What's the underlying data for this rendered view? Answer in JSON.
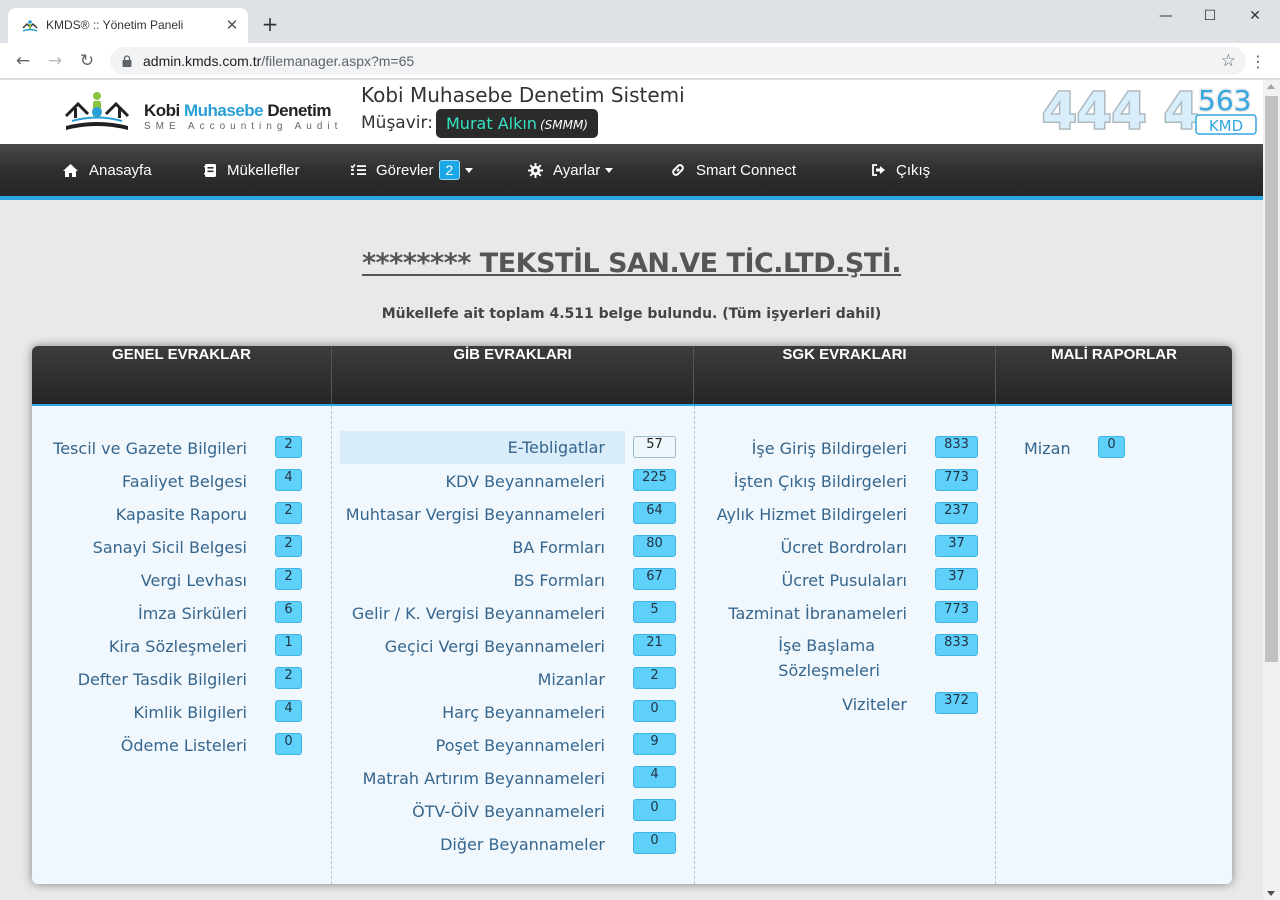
{
  "browser": {
    "tab_title": "KMDS® :: Yönetim Paneli",
    "url_domain": "admin.kmds.com.tr",
    "url_path": "/filemanager.aspx?m=65"
  },
  "header": {
    "logo_name_part1": "Kobi ",
    "logo_name_part2": "Muhasebe",
    "logo_name_part3": " Denetim",
    "logo_sub": "SME Accounting Audit",
    "system_title": "Kobi Muhasebe Denetim Sistemi",
    "advisor_label": "Müşavir:",
    "advisor_name": "Murat Alkın",
    "advisor_title": "(SMMM)",
    "phone_main": "444 4",
    "phone_extra": "563",
    "phone_sub": "KMD"
  },
  "nav": {
    "items": [
      {
        "label": "Anasayfa"
      },
      {
        "label": "Mükellefler"
      },
      {
        "label": "Görevler",
        "badge": "2"
      },
      {
        "label": "Ayarlar"
      },
      {
        "label": "Smart Connect"
      },
      {
        "label": "Çıkış"
      }
    ]
  },
  "company_name": "******** TEKSTİL SAN.VE TİC.LTD.ŞTİ.",
  "document_count_text": "Mükellefe ait toplam 4.511 belge bulundu. (Tüm işyerleri dahil)",
  "columns": [
    {
      "title": "GENEL EVRAKLAR",
      "rows": [
        {
          "label": "Tescil ve Gazete Bilgileri",
          "count": "2"
        },
        {
          "label": "Faaliyet Belgesi",
          "count": "4"
        },
        {
          "label": "Kapasite Raporu",
          "count": "2"
        },
        {
          "label": "Sanayi Sicil Belgesi",
          "count": "2"
        },
        {
          "label": "Vergi Levhası",
          "count": "2"
        },
        {
          "label": "İmza Sirküleri",
          "count": "6"
        },
        {
          "label": "Kira Sözleşmeleri",
          "count": "1"
        },
        {
          "label": "Defter Tasdik Bilgileri",
          "count": "2"
        },
        {
          "label": "Kimlik Bilgileri",
          "count": "4"
        },
        {
          "label": "Ödeme Listeleri",
          "count": "0"
        }
      ]
    },
    {
      "title": "GİB EVRAKLARI",
      "rows": [
        {
          "label": "E-Tebligatlar",
          "count": "57",
          "active": true
        },
        {
          "label": "KDV Beyannameleri",
          "count": "225"
        },
        {
          "label": "Muhtasar Vergisi Beyannameleri",
          "count": "64"
        },
        {
          "label": "BA Formları",
          "count": "80"
        },
        {
          "label": "BS Formları",
          "count": "67"
        },
        {
          "label": "Gelir / K. Vergisi Beyannameleri",
          "count": "5"
        },
        {
          "label": "Geçici Vergi Beyannameleri",
          "count": "21"
        },
        {
          "label": "Mizanlar",
          "count": "2"
        },
        {
          "label": "Harç Beyannameleri",
          "count": "0"
        },
        {
          "label": "Poşet Beyannameleri",
          "count": "9"
        },
        {
          "label": "Matrah Artırım Beyannameleri",
          "count": "4"
        },
        {
          "label": "ÖTV-ÖİV Beyannameleri",
          "count": "0"
        },
        {
          "label": "Diğer Beyannameler",
          "count": "0"
        }
      ]
    },
    {
      "title": "SGK EVRAKLARI",
      "rows": [
        {
          "label": "İşe Giriş Bildirgeleri",
          "count": "833"
        },
        {
          "label": "İşten Çıkış Bildirgeleri",
          "count": "773"
        },
        {
          "label": "Aylık Hizmet Bildirgeleri",
          "count": "237"
        },
        {
          "label": "Ücret Bordroları",
          "count": "37"
        },
        {
          "label": "Ücret Pusulaları",
          "count": "37"
        },
        {
          "label": "Tazminat İbranameleri",
          "count": "773"
        },
        {
          "label": "İşe Başlama Sözleşmeleri",
          "line1": "İşe Başlama",
          "line2": "Sözleşmeleri",
          "count": "833"
        },
        {
          "label": "Viziteler",
          "count": "372"
        }
      ]
    },
    {
      "title": "MALİ RAPORLAR",
      "rows": [
        {
          "label": "Mizan",
          "count": "0"
        }
      ]
    }
  ],
  "colors": {
    "accent": "#2aa6e0",
    "badge": "#5fd0fa",
    "label": "#36658d",
    "advisor_name": "#35e2c3"
  }
}
